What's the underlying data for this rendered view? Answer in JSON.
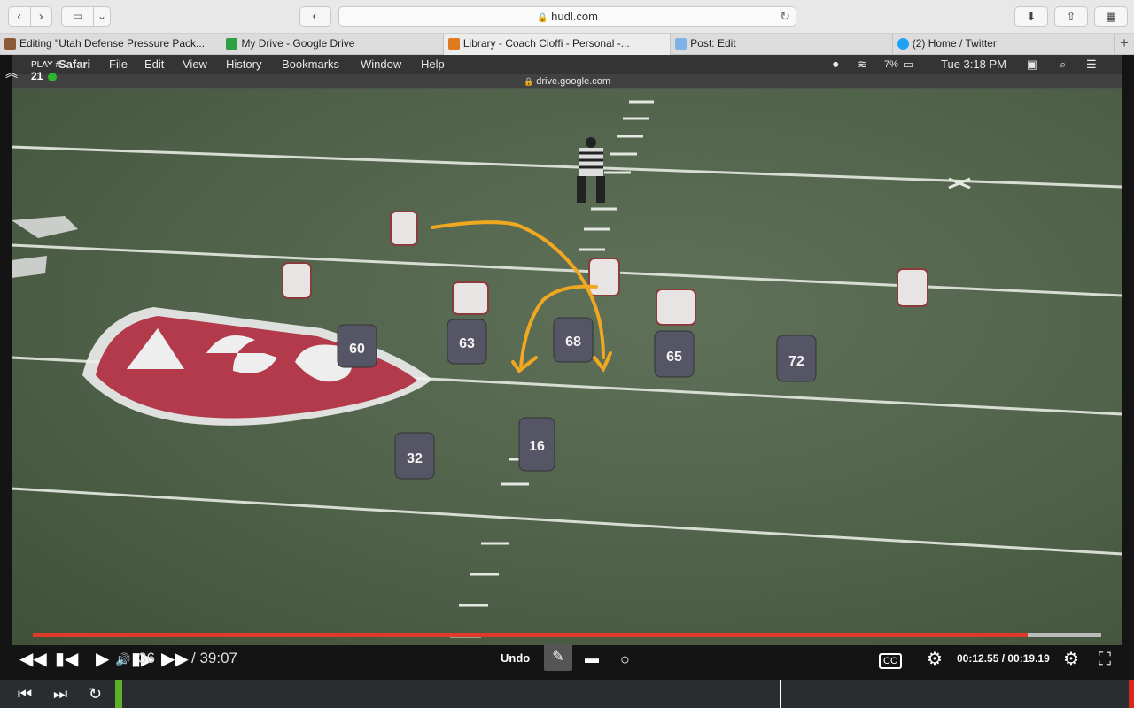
{
  "browser": {
    "url": "hudl.com",
    "tabs": [
      {
        "label": "Editing \"Utah Defense Pressure Pack...",
        "color": "#8a5a3a"
      },
      {
        "label": "My Drive - Google Drive",
        "color": "#2f9e44"
      },
      {
        "label": "Library - Coach Cioffi - Personal -...",
        "color": "#e07a1f"
      },
      {
        "label": "Post: Edit",
        "color": "#7fb2e5"
      },
      {
        "label": "(2) Home / Twitter",
        "color": "#1da1f2"
      }
    ],
    "new_tab": "+"
  },
  "overlay": {
    "menu": [
      "Safari",
      "File",
      "Edit",
      "View",
      "History",
      "Bookmarks",
      "Window",
      "Help"
    ],
    "battery": "7%",
    "clock": "Tue 3:18 PM",
    "address": "drive.google.com",
    "play_label": "PLAY #",
    "play_number": "21"
  },
  "video": {
    "jerseys": [
      "60",
      "63",
      "68",
      "65",
      "72",
      "32",
      "16"
    ],
    "progress": 0.931
  },
  "controls": {
    "elapsed_partial": "36",
    "duration": "/ 39:07",
    "undo": "Undo",
    "clip_time": "00:12.55 / 00:19.19",
    "cc": "CC"
  },
  "icons": {
    "back": "chevron-left-icon",
    "forward": "chevron-right-icon",
    "sidebar": "sidebar-icon",
    "shield": "shield-icon",
    "reload": "reload-icon",
    "download": "download-icon",
    "share": "share-icon",
    "tabs": "tab-overview-icon"
  }
}
